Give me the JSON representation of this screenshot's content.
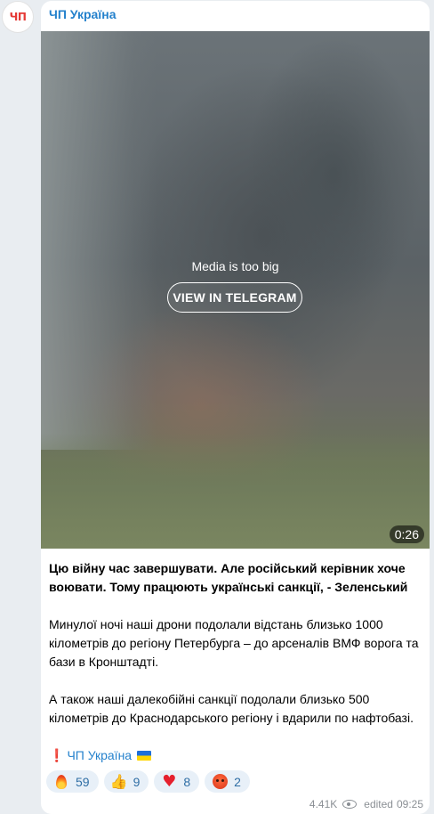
{
  "channel": {
    "avatar_text": "ЧП",
    "name": "ЧП Україна"
  },
  "media": {
    "notice": "Media is too big",
    "button_label": "VIEW IN TELEGRAM",
    "duration": "0:26"
  },
  "message": {
    "headline": "Цю війну час завершувати. Але російський керівник хоче воювати. Тому працюють українські санкції, - Зеленський",
    "paragraph_1": "Минулої ночі наші дрони подолали відстань близько 1000 кілометрів до регіону Петербурга – до арсеналів ВМФ ворога та бази в Кронштадті.",
    "paragraph_2": "А також наші далекобійні санкції подолали близько 500 кілометрів до Краснодарського регіону і вдарили по нафтобазі.",
    "signature_mark": "❗",
    "signature_link": "ЧП Україна"
  },
  "reactions": [
    {
      "icon": "fire-icon",
      "count": "59"
    },
    {
      "icon": "thumbs-up-icon",
      "count": "9"
    },
    {
      "icon": "heart-icon",
      "count": "8"
    },
    {
      "icon": "angry-face-icon",
      "count": "2"
    }
  ],
  "meta": {
    "views": "4.41K",
    "edited_label": "edited",
    "time": "09:25"
  }
}
